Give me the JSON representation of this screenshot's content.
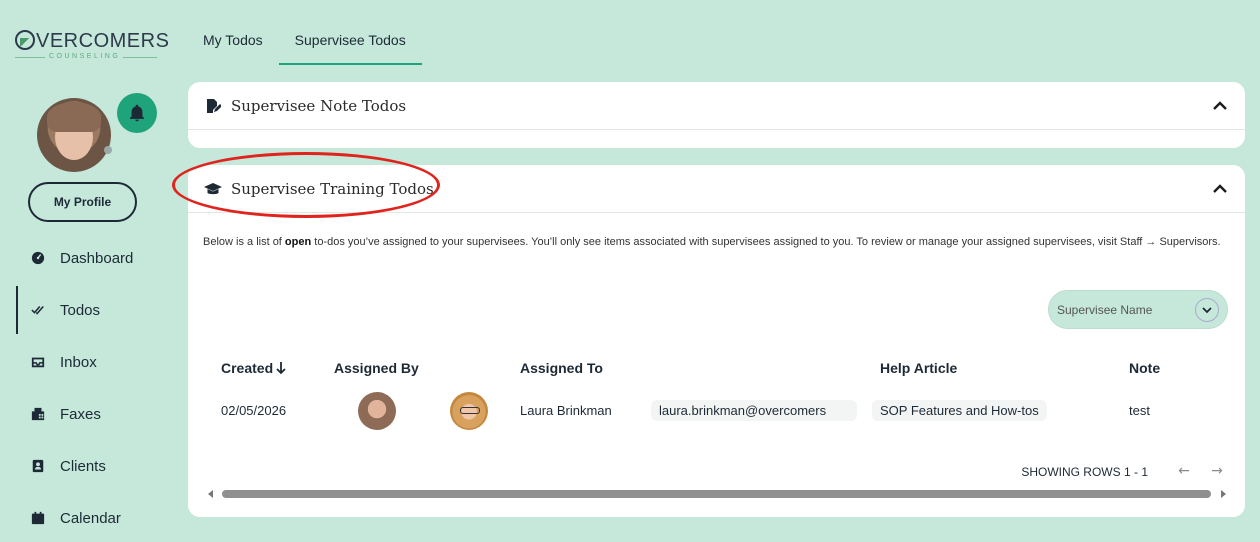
{
  "brand": {
    "name": "VERCOMERS",
    "tagline": "COUNSELING"
  },
  "sidebar": {
    "profile_button": "My Profile",
    "items": [
      {
        "label": "Dashboard",
        "icon": "dashboard-icon"
      },
      {
        "label": "Todos",
        "icon": "check-icon"
      },
      {
        "label": "Inbox",
        "icon": "inbox-icon"
      },
      {
        "label": "Faxes",
        "icon": "fax-icon"
      },
      {
        "label": "Clients",
        "icon": "contacts-icon"
      },
      {
        "label": "Calendar",
        "icon": "calendar-icon"
      }
    ]
  },
  "tabs": [
    {
      "label": "My Todos",
      "active": false
    },
    {
      "label": "Supervisee Todos",
      "active": true
    }
  ],
  "note_card": {
    "title": "Supervisee Note Todos"
  },
  "training_card": {
    "title": "Supervisee Training Todos",
    "desc_before": "Below is a list of ",
    "desc_bold": "open",
    "desc_after": " to-dos you’ve assigned to your supervisees. You’ll only see items associated with supervisees assigned to you. To review or manage your assigned supervisees, visit Staff → Supervisors.",
    "filter_placeholder": "Supervisee Name",
    "columns": {
      "created": "Created",
      "assigned_by": "Assigned By",
      "assigned_to": "Assigned To",
      "help_article": "Help Article",
      "note": "Note"
    },
    "rows": [
      {
        "created": "02/05/2026",
        "assigned_to_name": "Laura Brinkman",
        "assigned_to_email": "laura.brinkman@overcomers",
        "help_article": "SOP Features and How-tos",
        "note": "test"
      }
    ],
    "rows_info": "SHOWING ROWS 1 - 1"
  },
  "colors": {
    "background": "#c5e8da",
    "accent": "#1fa37a",
    "annotation": "#e0241d"
  }
}
